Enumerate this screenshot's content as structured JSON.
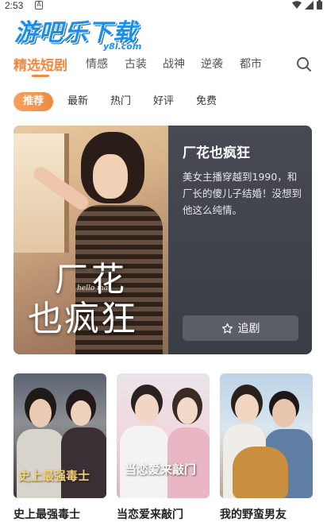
{
  "status_bar": {
    "time": "2:53",
    "app_icon": "A"
  },
  "watermark": {
    "text": "游吧乐下载",
    "sub": "y8l.com"
  },
  "category_tabs": [
    {
      "label": "精选短剧",
      "active": true
    },
    {
      "label": "情感",
      "active": false
    },
    {
      "label": "古装",
      "active": false
    },
    {
      "label": "战神",
      "active": false
    },
    {
      "label": "逆袭",
      "active": false
    },
    {
      "label": "都市",
      "active": false
    }
  ],
  "filters": [
    {
      "label": "推荐",
      "active": true
    },
    {
      "label": "最新",
      "active": false
    },
    {
      "label": "热门",
      "active": false
    },
    {
      "label": "好评",
      "active": false
    },
    {
      "label": "免费",
      "active": false
    }
  ],
  "featured": {
    "title": "厂花也疯狂",
    "description": "美女主播穿越到1990，和厂长的傻儿子结婚！没想到他这么纯情。",
    "poster_title_line1": "厂花",
    "poster_title_line2": "也疯狂",
    "poster_script": "hello ma",
    "follow_label": "追剧",
    "follow_icon": "star-outline-icon"
  },
  "dramas": [
    {
      "title": "史上最强毒士",
      "poster_caption": "史上最强毒士"
    },
    {
      "title": "当恋爱来敲门",
      "poster_caption": "当恋爱来敲门"
    },
    {
      "title": "我的野蛮男友",
      "poster_caption": ""
    }
  ],
  "colors": {
    "accent": "#f08a44",
    "featured_bg": "#3a3d45",
    "watermark": "#1b8ee8"
  }
}
